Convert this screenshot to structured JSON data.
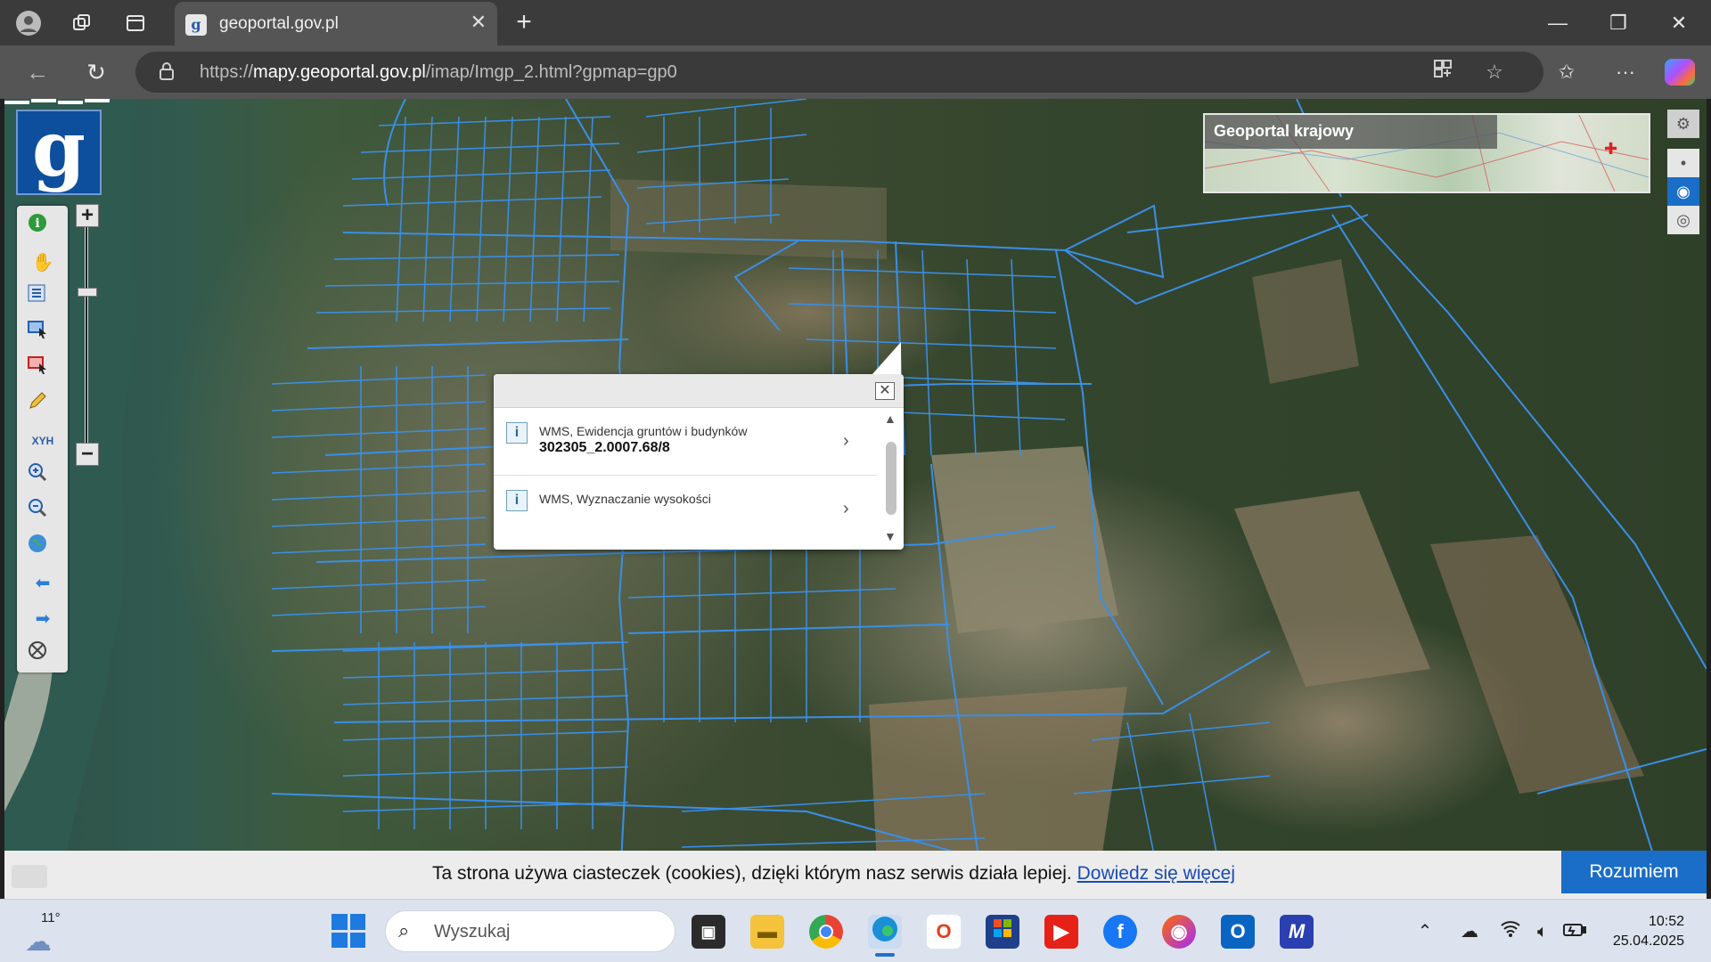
{
  "browser": {
    "tab_title": "geoportal.gov.pl",
    "url_prefix": "https://",
    "url_host": "mapy.geoportal.gov.pl",
    "url_path": "/imap/Imgp_2.html?gpmap=gp0"
  },
  "map": {
    "overview_label": "Geoportal krajowy",
    "popup": {
      "items": [
        {
          "source": "WMS, Ewidencja gruntów i budynków",
          "value": "302305_2.0007.68/8"
        },
        {
          "source": "WMS, Wyznaczanie wysokości",
          "value": ""
        }
      ]
    }
  },
  "cookie_bar": {
    "text": "Ta strona używa ciasteczek (cookies), dzięki którym nasz serwis działa lepiej.",
    "link": "Dowiedz się więcej",
    "accept": "Rozumiem"
  },
  "taskbar": {
    "weather_temp": "11°",
    "search_placeholder": "Wyszukaj",
    "time": "10:52",
    "date": "25.04.2025"
  },
  "icons": {
    "browser": [
      "profile-icon",
      "workspaces-icon",
      "tab-actions-icon",
      "back-icon",
      "refresh-icon",
      "lock-icon",
      "app-icon",
      "favorite-icon",
      "favorites-icon",
      "more-icon",
      "copilot-icon"
    ],
    "map_tools": [
      "info-icon",
      "pan-icon",
      "legend-icon",
      "select-icon",
      "clear-selection-icon",
      "draw-icon",
      "xyh-icon",
      "zoom-in-icon",
      "zoom-out-icon",
      "full-extent-icon",
      "previous-view-icon",
      "next-view-icon",
      "reset-icon"
    ]
  },
  "colors": {
    "parcel_lines": "#3a8fe8",
    "cookie_button": "#1a6ec8",
    "logo_bg": "#0d4f9c"
  }
}
